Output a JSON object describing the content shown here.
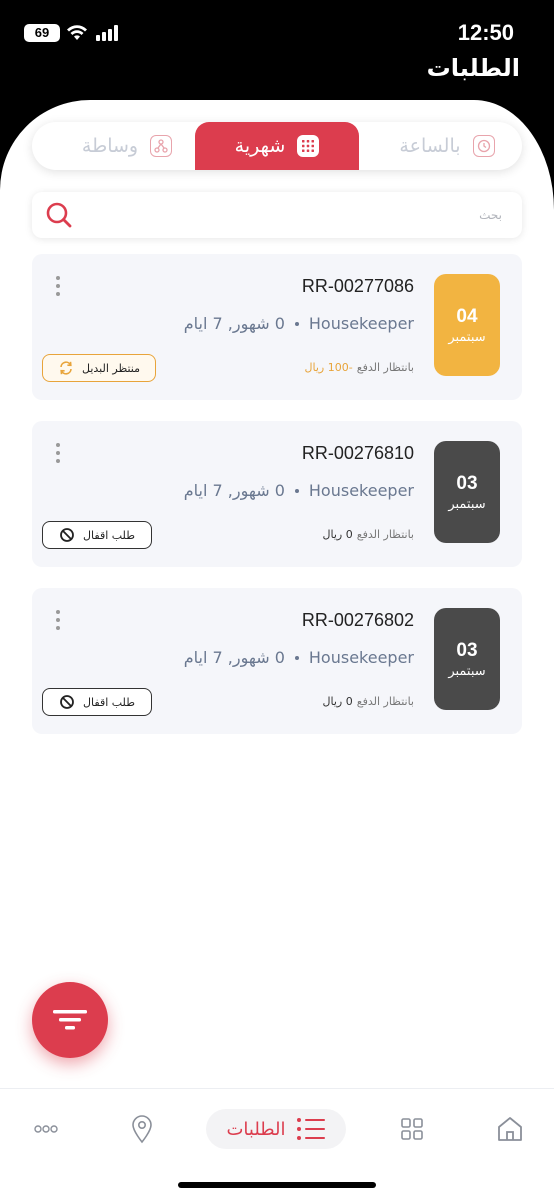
{
  "status_bar": {
    "time": "12:50",
    "battery": "69"
  },
  "header": {
    "title": "الطلبات"
  },
  "tabs": [
    {
      "label": "وساطة",
      "icon": "network-icon",
      "active": false
    },
    {
      "label": "شهرية",
      "icon": "calendar-icon",
      "active": true
    },
    {
      "label": "بالساعة",
      "icon": "clock-icon",
      "active": false
    }
  ],
  "search": {
    "placeholder": "بحث"
  },
  "orders": [
    {
      "id": "RR-00277086",
      "day": "04",
      "month": "سبتمبر",
      "date_color": "#f2b441",
      "role": "Housekeeper",
      "duration": "0 شهور, 7 ايام",
      "amount": "-100 ريال",
      "amount_negative": true,
      "payment_status": "بانتظار الدفع",
      "badge": "منتظر البديل",
      "badge_type": "pending"
    },
    {
      "id": "RR-00276810",
      "day": "03",
      "month": "سبتمبر",
      "date_color": "#4a4a4a",
      "role": "Housekeeper",
      "duration": "0 شهور, 7 ايام",
      "amount": "0 ريال",
      "amount_negative": false,
      "payment_status": "بانتظار الدفع",
      "badge": "طلب اقفال",
      "badge_type": "close"
    },
    {
      "id": "RR-00276802",
      "day": "03",
      "month": "سبتمبر",
      "date_color": "#4a4a4a",
      "role": "Housekeeper",
      "duration": "0 شهور, 7 ايام",
      "amount": "0 ريال",
      "amount_negative": false,
      "payment_status": "بانتظار الدفع",
      "badge": "طلب اقفال",
      "badge_type": "close"
    }
  ],
  "bottom_nav": {
    "orders_label": "الطلبات",
    "items": [
      "more-icon",
      "location-icon",
      "orders-list-icon",
      "grid-icon",
      "home-icon"
    ]
  },
  "colors": {
    "accent": "#dc3d4e",
    "pending": "#e8a43a"
  }
}
